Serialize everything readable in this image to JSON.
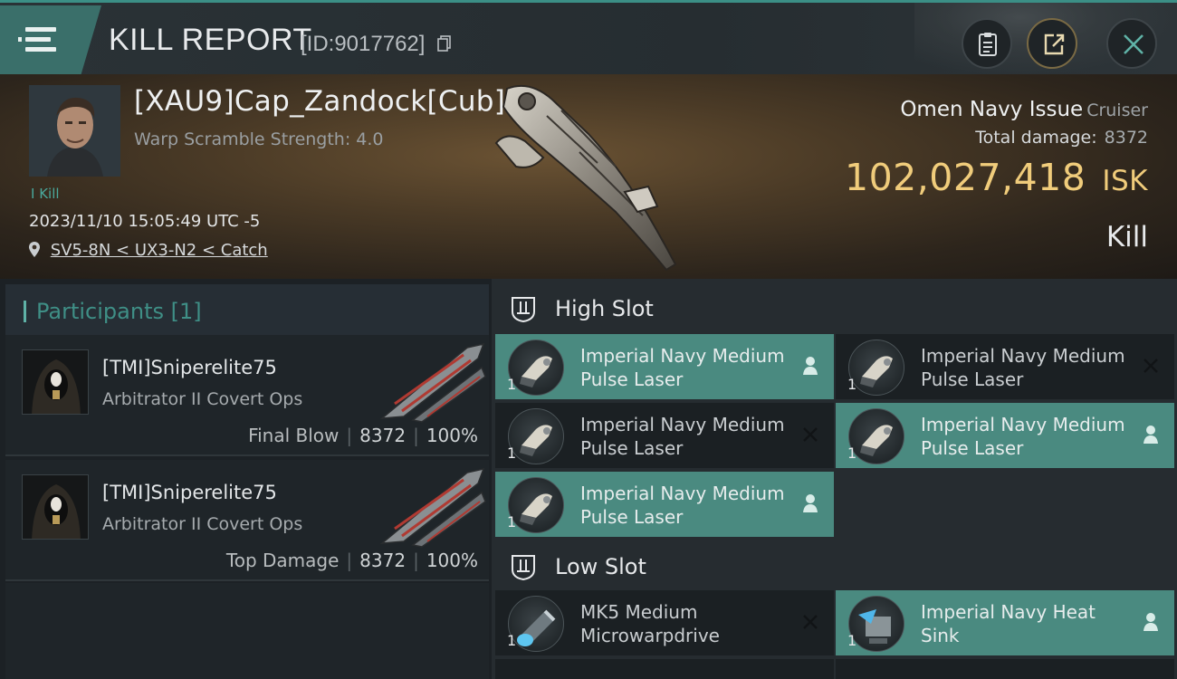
{
  "header": {
    "title": "KILL REPORT",
    "kill_id": "[ID:9017762]"
  },
  "victim": {
    "pilot_name": "[XAU9]Cap_Zandock[Cub]",
    "warp_scramble": "Warp Scramble Strength: 4.0",
    "kill_tag": "I Kill",
    "datetime": "2023/11/10 15:05:49 UTC -5",
    "location": "SV5-8N < UX3-N2 < Catch",
    "ship_name": "Omen Navy Issue",
    "ship_class": "Cruiser",
    "total_damage_label": "Total damage:",
    "total_damage": "8372",
    "isk_value": "102,027,418",
    "isk_unit": "ISK",
    "result": "Kill"
  },
  "participants": {
    "header": "Participants [1]",
    "items": [
      {
        "name": "[TMI]Sniperelite75",
        "ship": "Arbitrator II Covert Ops",
        "role": "Final Blow",
        "damage": "8372",
        "percent": "100%"
      },
      {
        "name": "[TMI]Sniperelite75",
        "ship": "Arbitrator II Covert Ops",
        "role": "Top Damage",
        "damage": "8372",
        "percent": "100%"
      }
    ]
  },
  "fittings": {
    "high_slot_label": "High Slot",
    "low_slot_label": "Low Slot",
    "high": [
      {
        "name": "Imperial Navy Medium Pulse Laser",
        "qty": "1",
        "state": "dropped"
      },
      {
        "name": "Imperial Navy Medium Pulse Laser",
        "qty": "1",
        "state": "destroyed"
      },
      {
        "name": "Imperial Navy Medium Pulse Laser",
        "qty": "1",
        "state": "destroyed"
      },
      {
        "name": "Imperial Navy Medium Pulse Laser",
        "qty": "1",
        "state": "dropped"
      },
      {
        "name": "Imperial Navy Medium Pulse Laser",
        "qty": "1",
        "state": "dropped"
      }
    ],
    "low": [
      {
        "name": "MK5 Medium Microwarpdrive",
        "qty": "1",
        "state": "destroyed"
      },
      {
        "name": "Imperial Navy Heat Sink",
        "qty": "1",
        "state": "dropped"
      }
    ]
  },
  "colors": {
    "accent_teal": "#4a8a80",
    "isk_gold": "#f0cc7b",
    "panel_dark": "#1b2023"
  }
}
